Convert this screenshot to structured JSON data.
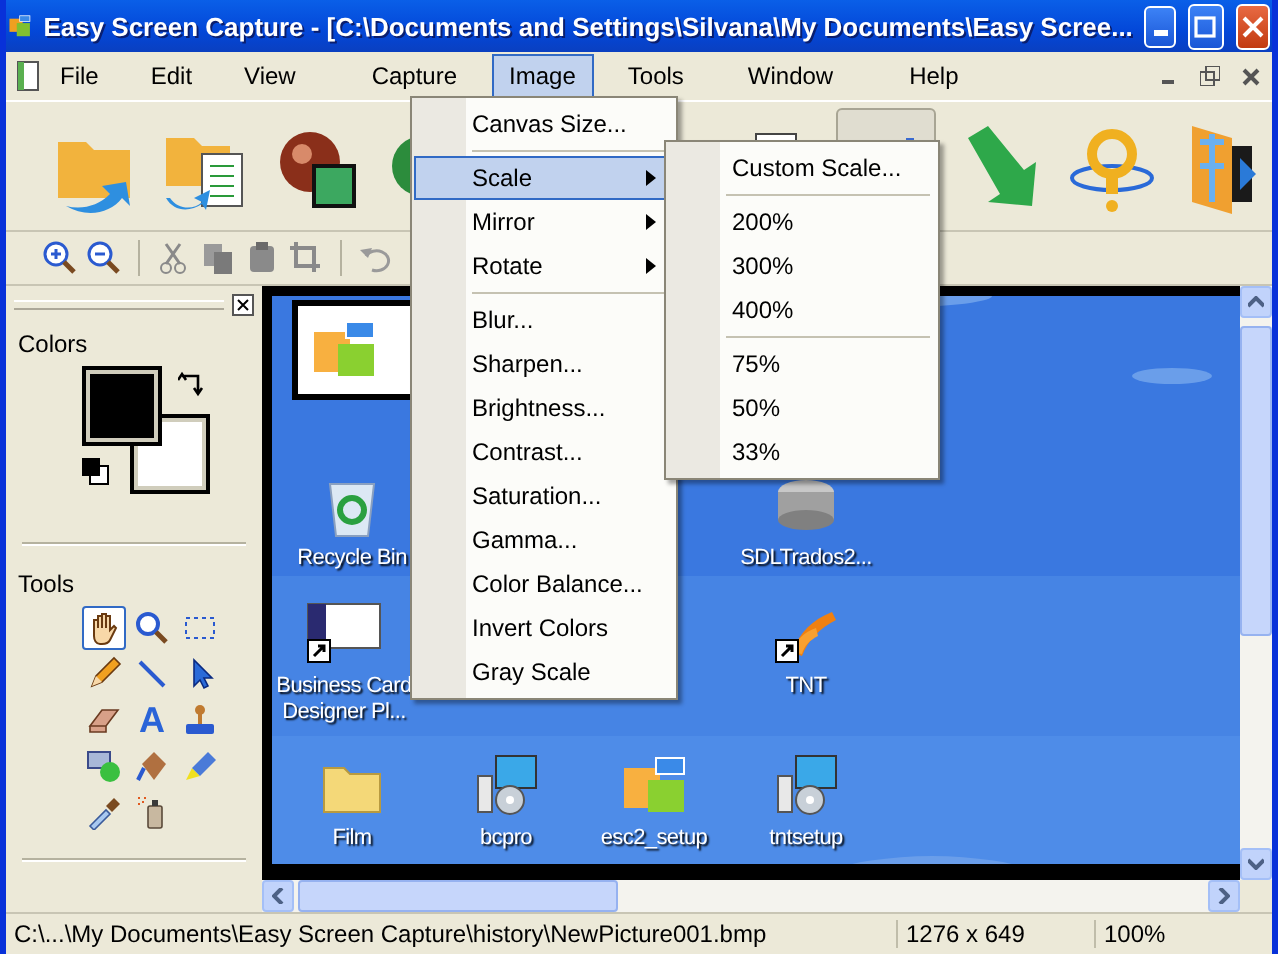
{
  "window": {
    "title": "Easy Screen Capture - [C:\\Documents and Settings\\Silvana\\My Documents\\Easy Scree..."
  },
  "menu_bar": [
    {
      "label": "File",
      "selected": false
    },
    {
      "label": "Edit",
      "selected": false
    },
    {
      "label": "View",
      "selected": false
    },
    {
      "label": "Capture",
      "selected": false
    },
    {
      "label": "Image",
      "selected": true
    },
    {
      "label": "Tools",
      "selected": false
    },
    {
      "label": "Window",
      "selected": false
    },
    {
      "label": "Help",
      "selected": false
    }
  ],
  "image_menu": [
    {
      "kind": "item",
      "label": "Canvas Size...",
      "selected": false,
      "submenu": false
    },
    {
      "kind": "separator"
    },
    {
      "kind": "item",
      "label": "Scale",
      "selected": true,
      "submenu": true
    },
    {
      "kind": "item",
      "label": "Mirror",
      "selected": false,
      "submenu": true
    },
    {
      "kind": "item",
      "label": "Rotate",
      "selected": false,
      "submenu": true
    },
    {
      "kind": "separator"
    },
    {
      "kind": "item",
      "label": "Blur...",
      "selected": false,
      "submenu": false
    },
    {
      "kind": "item",
      "label": "Sharpen...",
      "selected": false,
      "submenu": false
    },
    {
      "kind": "item",
      "label": "Brightness...",
      "selected": false,
      "submenu": false
    },
    {
      "kind": "item",
      "label": "Contrast...",
      "selected": false,
      "submenu": false
    },
    {
      "kind": "item",
      "label": "Saturation...",
      "selected": false,
      "submenu": false
    },
    {
      "kind": "item",
      "label": "Gamma...",
      "selected": false,
      "submenu": false
    },
    {
      "kind": "item",
      "label": "Color Balance...",
      "selected": false,
      "submenu": false
    },
    {
      "kind": "item",
      "label": "Invert Colors",
      "selected": false,
      "submenu": false
    },
    {
      "kind": "item",
      "label": "Gray Scale",
      "selected": false,
      "submenu": false
    }
  ],
  "scale_submenu": [
    {
      "kind": "item",
      "label": "Custom Scale..."
    },
    {
      "kind": "separator"
    },
    {
      "kind": "item",
      "label": "200%"
    },
    {
      "kind": "item",
      "label": "300%"
    },
    {
      "kind": "item",
      "label": "400%"
    },
    {
      "kind": "separator"
    },
    {
      "kind": "item",
      "label": "75%"
    },
    {
      "kind": "item",
      "label": "50%"
    },
    {
      "kind": "item",
      "label": "33%"
    }
  ],
  "colors_panel": {
    "title": "Colors"
  },
  "tools_panel": {
    "title": "Tools",
    "tools": [
      {
        "kind": "hand",
        "selected": true
      },
      {
        "kind": "zoom",
        "selected": false
      },
      {
        "kind": "select",
        "selected": false
      },
      {
        "kind": "pencil",
        "selected": false
      },
      {
        "kind": "line",
        "selected": false
      },
      {
        "kind": "pointer",
        "selected": false
      },
      {
        "kind": "eraser",
        "selected": false
      },
      {
        "kind": "text",
        "glyph": "A",
        "selected": false
      },
      {
        "kind": "stamp",
        "selected": false
      },
      {
        "kind": "shapes",
        "selected": false
      },
      {
        "kind": "fill",
        "selected": false
      },
      {
        "kind": "highlighter",
        "selected": false
      },
      {
        "kind": "dropper",
        "selected": false
      },
      {
        "kind": "spray",
        "selected": false
      }
    ]
  },
  "desktop_icons": [
    {
      "kind": "recycle",
      "label": "Recycle Bin"
    },
    {
      "kind": "drive",
      "label": "SDLTrados2..."
    },
    {
      "kind": "card",
      "label": "Business Card Designer Pl..."
    },
    {
      "kind": "tnt",
      "label": "TNT"
    },
    {
      "kind": "folder",
      "label": "Film"
    },
    {
      "kind": "setup",
      "label": "bcpro"
    },
    {
      "kind": "esc",
      "label": "esc2_setup"
    },
    {
      "kind": "setup",
      "label": "tntsetup"
    }
  ],
  "status_bar": {
    "path": "C:\\...\\My Documents\\Easy Screen Capture\\history\\NewPicture001.bmp",
    "dimensions": "1276 x 649",
    "zoom": "100%"
  }
}
